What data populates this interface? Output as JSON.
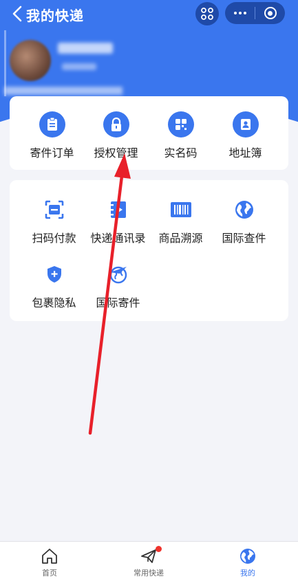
{
  "header": {
    "title": "我的快递",
    "back_icon": "chevron-left-icon",
    "scan_icon": "scan-icon",
    "more_icon": "more-dots-icon",
    "close_icon": "mini-program-close-icon"
  },
  "colors": {
    "primary": "#3a76ee",
    "capsule": "#1f4aa8",
    "background": "#f3f4f9",
    "badge": "#f0322c",
    "annotation_arrow": "#e8202a"
  },
  "quick_actions": [
    {
      "label": "寄件订单",
      "icon": "order-clipboard-icon"
    },
    {
      "label": "授权管理",
      "icon": "lock-icon"
    },
    {
      "label": "实名码",
      "icon": "qr-grid-icon"
    },
    {
      "label": "地址簿",
      "icon": "contact-book-icon"
    }
  ],
  "services": [
    {
      "label": "扫码付款",
      "icon": "scan-pay-icon"
    },
    {
      "label": "快递通讯录",
      "icon": "address-book-icon"
    },
    {
      "label": "商品溯源",
      "icon": "barcode-icon"
    },
    {
      "label": "国际查件",
      "icon": "globe-icon"
    },
    {
      "label": "包裹隐私",
      "icon": "shield-plus-icon"
    },
    {
      "label": "国际寄件",
      "icon": "globe-plane-icon"
    }
  ],
  "tabbar": {
    "tabs": [
      {
        "label": "首页",
        "icon": "home-icon",
        "active": false
      },
      {
        "label": "常用快递",
        "icon": "paper-plane-icon",
        "active": false,
        "badge": true
      },
      {
        "label": "我的",
        "icon": "profile-globe-icon",
        "active": true
      }
    ]
  }
}
